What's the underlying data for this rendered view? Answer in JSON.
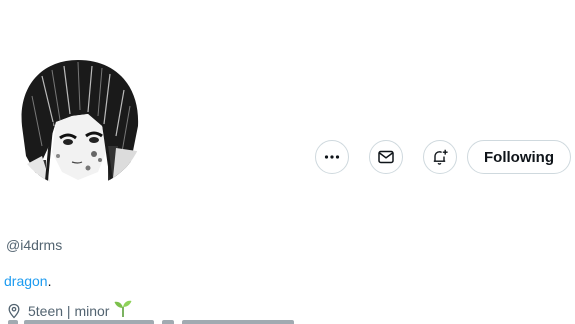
{
  "profile": {
    "avatar_alt": "",
    "handle": "@i4drms",
    "bio_link": "dragon",
    "bio_tail": ".",
    "location": "5teen | minor"
  },
  "actions": {
    "more_icon": "more-horizontal-icon",
    "message_icon": "mail-icon",
    "notify_icon": "bell-plus-icon",
    "following_label": "Following"
  },
  "colors": {
    "accent": "#1d9bf0",
    "muted": "#536471",
    "border": "#cfd9de",
    "text": "#0f1419"
  }
}
